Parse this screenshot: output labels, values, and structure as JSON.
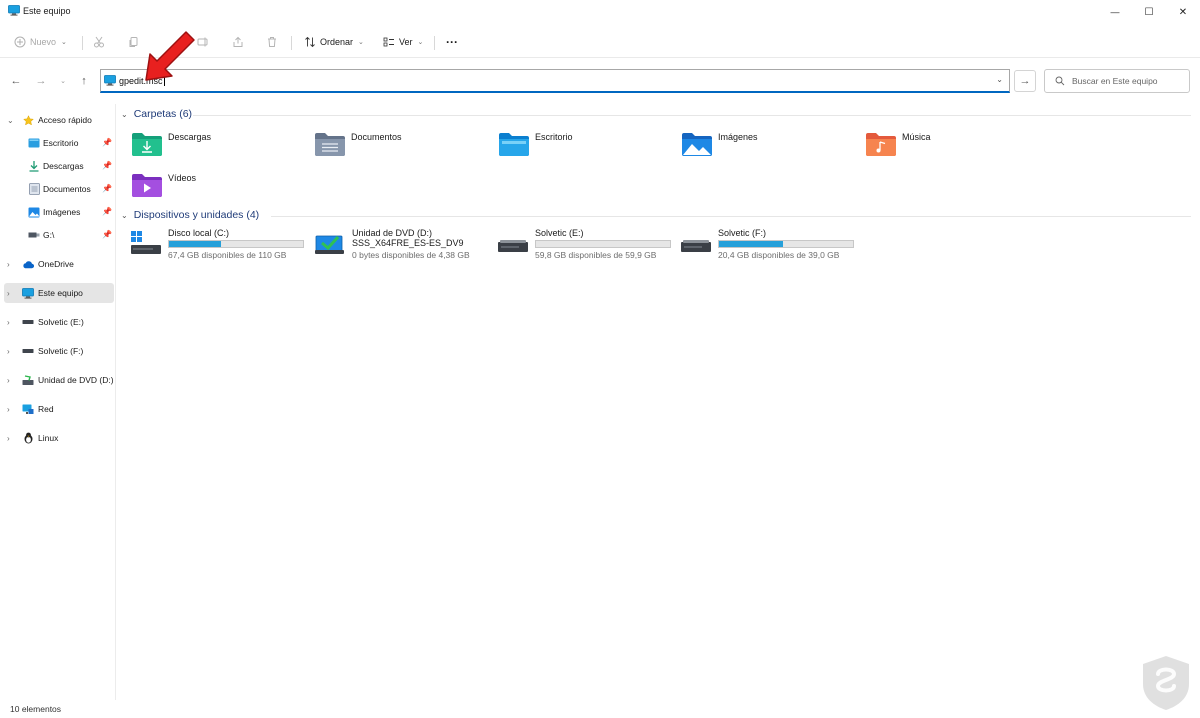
{
  "window": {
    "title": "Este equipo",
    "min_glyph": "—",
    "max_glyph": "☐",
    "close_glyph": "✕"
  },
  "toolbar": {
    "new_label": "Nuevo",
    "sort_label": "Ordenar",
    "view_label": "Ver",
    "more_glyph": "···"
  },
  "address": {
    "value": "gpedit.msc",
    "search_placeholder": "Buscar en Este equipo"
  },
  "sidebar": {
    "quick_access": "Acceso rápido",
    "quick_items": [
      {
        "label": "Escritorio"
      },
      {
        "label": "Descargas"
      },
      {
        "label": "Documentos"
      },
      {
        "label": "Imágenes"
      },
      {
        "label": "G:\\"
      }
    ],
    "onedrive": "OneDrive",
    "this_pc": "Este equipo",
    "drive_e": "Solvetic (E:)",
    "drive_f": "Solvetic (F:)",
    "dvd": "Unidad de DVD (D:)",
    "network": "Red",
    "linux": "Linux"
  },
  "folders_group": {
    "header": "Carpetas (6)",
    "items": [
      {
        "label": "Descargas"
      },
      {
        "label": "Documentos"
      },
      {
        "label": "Escritorio"
      },
      {
        "label": "Imágenes"
      },
      {
        "label": "Música"
      },
      {
        "label": "Vídeos"
      }
    ]
  },
  "devices_group": {
    "header": "Dispositivos y unidades (4)",
    "items": [
      {
        "label": "Disco local (C:)",
        "free": "67,4 GB disponibles de 110 GB",
        "used_fraction": 0.39
      },
      {
        "label": "Unidad de DVD (D:)",
        "sub": "SSS_X64FRE_ES-ES_DV9",
        "free": "0 bytes disponibles de 4,38 GB"
      },
      {
        "label": "Solvetic (E:)",
        "free": "59,8 GB disponibles de 59,9 GB",
        "used_fraction": 0.0
      },
      {
        "label": "Solvetic (F:)",
        "free": "20,4 GB disponibles de 39,0 GB",
        "used_fraction": 0.48
      }
    ]
  },
  "status": {
    "count": "10 elementos"
  },
  "colors": {
    "accent": "#0067c0",
    "bar_fill": "#26a0da",
    "annotation": "#e8201f"
  }
}
